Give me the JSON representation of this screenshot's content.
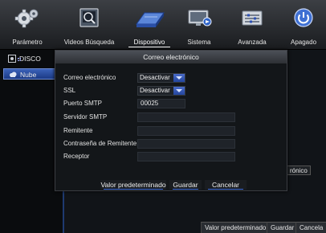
{
  "topbar": {
    "items": [
      {
        "label": "Parámetro",
        "icon": "gear-icon"
      },
      {
        "label": "Videos Búsqueda",
        "icon": "video-search-icon"
      },
      {
        "label": "Dispositivo",
        "icon": "hard-drive-icon"
      },
      {
        "label": "Sistema",
        "icon": "system-monitor-icon"
      },
      {
        "label": "Avanzada",
        "icon": "advanced-panel-icon"
      },
      {
        "label": "Apagado",
        "icon": "power-icon"
      }
    ],
    "active_index": 2
  },
  "sidebar": {
    "items": [
      {
        "label": "DISCO",
        "icon": "disk-icon"
      },
      {
        "label": "Nube",
        "icon": "cloud-icon"
      }
    ]
  },
  "background": {
    "partial_text": "rónico",
    "buttons": [
      "Valor predeterminado",
      "Guardar",
      "Cancela"
    ]
  },
  "modal": {
    "title": "Correo electrónico",
    "fields": {
      "email_label": "Correo electrónico",
      "email_value": "Desactivar",
      "ssl_label": "SSL",
      "ssl_value": "Desactivar",
      "smtp_port_label": "Puerto SMTP",
      "smtp_port_value": "00025",
      "smtp_server_label": "Servidor SMTP",
      "smtp_server_value": "",
      "sender_label": "Remitente",
      "sender_value": "",
      "sender_password_label": "Contraseña de Remitente",
      "sender_password_value": "",
      "receiver_label": "Receptor",
      "receiver_value": ""
    },
    "buttons": {
      "default": "Valor predeterminado",
      "save": "Guardar",
      "cancel": "Cancelar"
    }
  },
  "colors": {
    "accent": "#2c50b4",
    "background": "#111418",
    "panel": "#131619"
  }
}
